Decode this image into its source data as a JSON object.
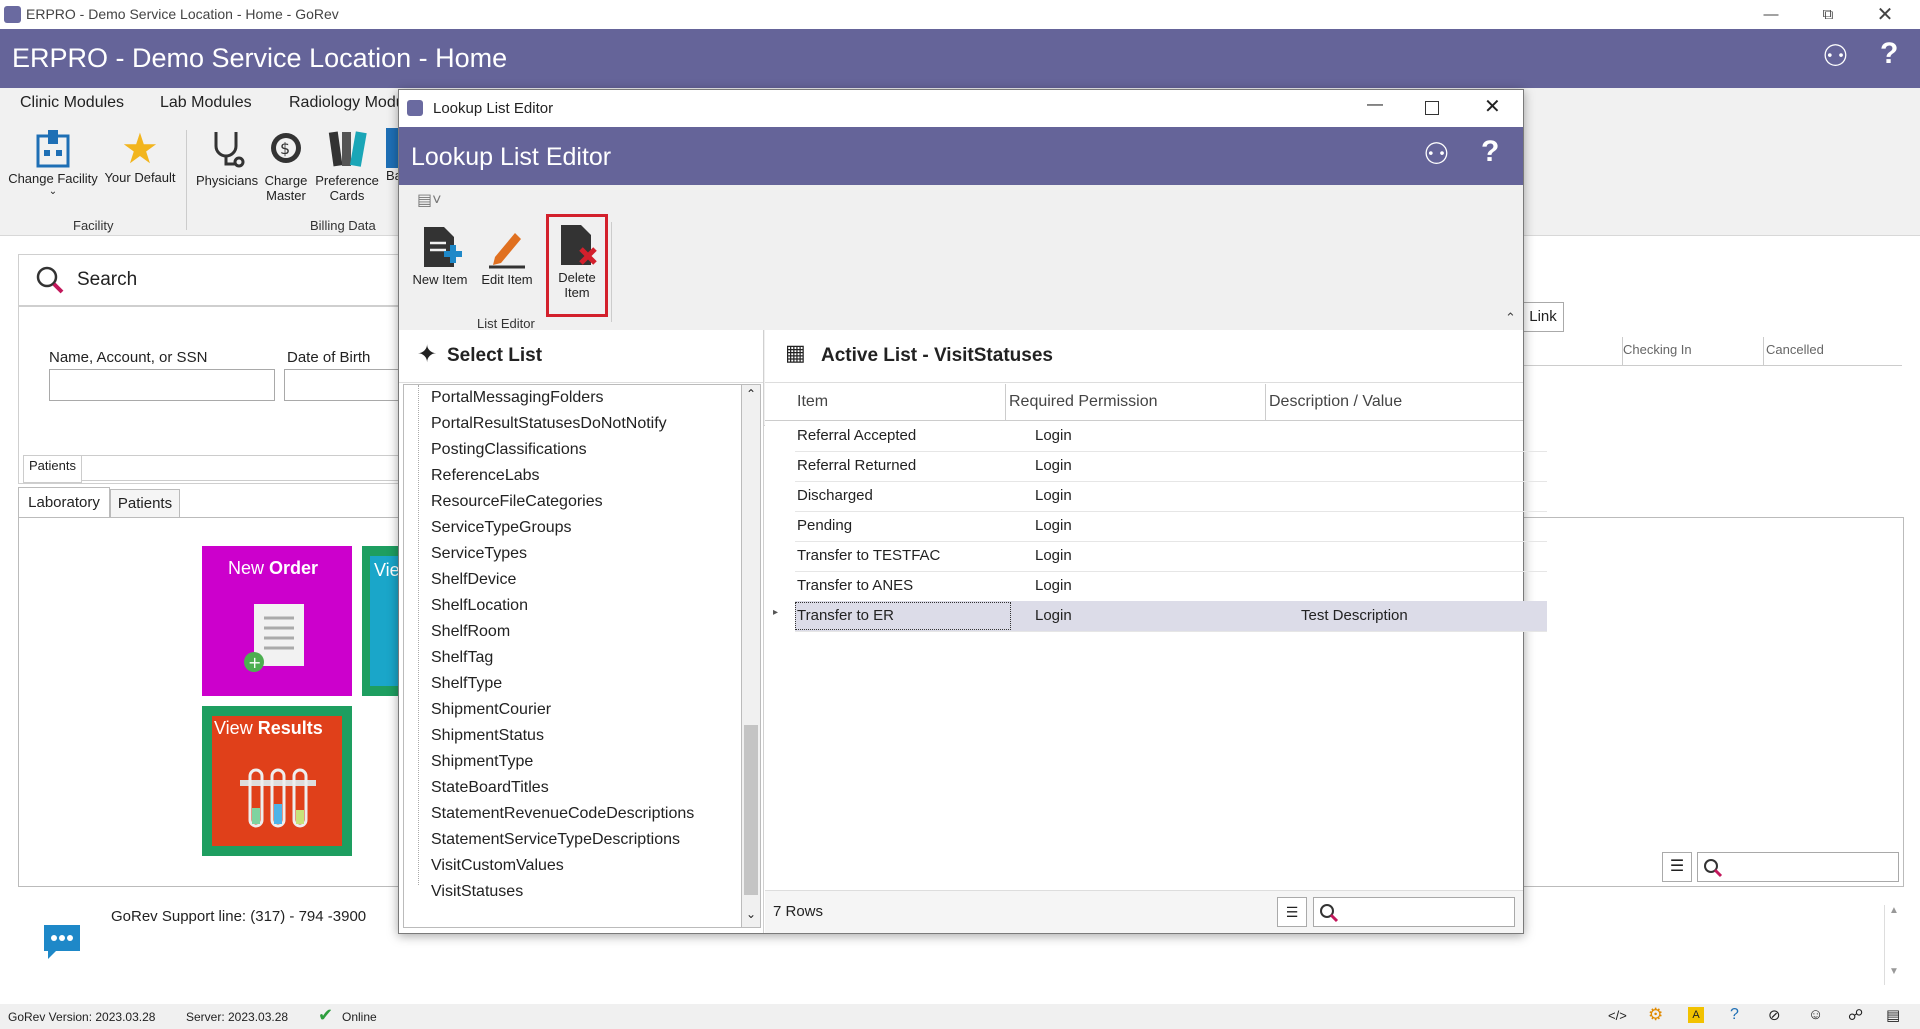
{
  "window": {
    "title": "ERPRO - Demo Service Location - Home - GoRev"
  },
  "header": {
    "title": "ERPRO - Demo Service Location - Home"
  },
  "menu_tabs": [
    "Clinic Modules",
    "Lab Modules",
    "Radiology Modu"
  ],
  "ribbon": {
    "change_facility": "Change Facility",
    "your_default": "Your Default",
    "facility_group": "Facility",
    "physicians": "Physicians",
    "charge_master_1": "Charge",
    "charge_master_2": "Master",
    "preference_1": "Preference",
    "preference_2": "Cards",
    "ba": "Ba",
    "billing_group": "Billing Data"
  },
  "search": {
    "title": "Search",
    "name_label": "Name, Account, or SSN",
    "dob_label": "Date of Birth",
    "patients_tab": "Patients"
  },
  "tabs": {
    "laboratory": "Laboratory",
    "patients": "Patients"
  },
  "tiles": {
    "new_order_1": "New ",
    "new_order_2": "Order",
    "view_partial": "Vie",
    "view_results_1": "View ",
    "view_results_2": "Results"
  },
  "right_grid": {
    "link_btn": "Link",
    "col_checking_in": "Checking In",
    "col_cancelled": "Cancelled"
  },
  "support": {
    "text": "GoRev Support line: (317) - 794 -3900"
  },
  "statusbar": {
    "version": "GoRev Version: 2023.03.28",
    "server": "Server: 2023.03.28",
    "online": "Online"
  },
  "modal": {
    "window_title": "Lookup List Editor",
    "header_title": "Lookup List Editor",
    "new_item": "New Item",
    "edit_item": "Edit Item",
    "delete_item_1": "Delete",
    "delete_item_2": "Item",
    "group_label": "List Editor",
    "select_list_title": "Select List",
    "active_list_title": "Active List - VisitStatuses",
    "lists": [
      "PortalMessagingFolders",
      "PortalResultStatusesDoNotNotify",
      "PostingClassifications",
      "ReferenceLabs",
      "ResourceFileCategories",
      "ServiceTypeGroups",
      "ServiceTypes",
      "ShelfDevice",
      "ShelfLocation",
      "ShelfRoom",
      "ShelfTag",
      "ShelfType",
      "ShipmentCourier",
      "ShipmentStatus",
      "ShipmentType",
      "StateBoardTitles",
      "StatementRevenueCodeDescriptions",
      "StatementServiceTypeDescriptions",
      "VisitCustomValues",
      "VisitStatuses"
    ],
    "columns": [
      "Item",
      "Required Permission",
      "Description / Value"
    ],
    "rows": [
      {
        "item": "Referral Accepted",
        "perm": "Login",
        "desc": ""
      },
      {
        "item": "Referral Returned",
        "perm": "Login",
        "desc": ""
      },
      {
        "item": "Discharged",
        "perm": "Login",
        "desc": ""
      },
      {
        "item": "Pending",
        "perm": "Login",
        "desc": ""
      },
      {
        "item": "Transfer to TESTFAC",
        "perm": "Login",
        "desc": ""
      },
      {
        "item": "Transfer to ANES",
        "perm": "Login",
        "desc": ""
      },
      {
        "item": "Transfer to ER",
        "perm": "Login",
        "desc": "Test Description"
      }
    ],
    "row_count": "7 Rows"
  }
}
